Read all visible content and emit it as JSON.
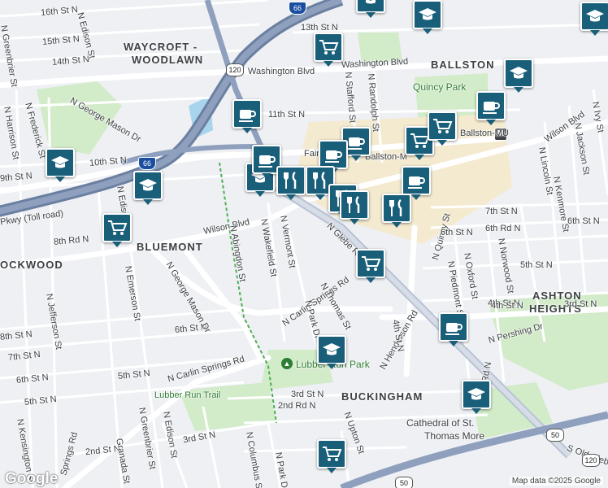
{
  "map": {
    "colors": {
      "road_major": "#ffffff",
      "highway": "#8a9bb5",
      "highway_dark": "#6b7fa0",
      "park": "#cfe8c6",
      "water": "#a8d4ee",
      "poi": "#1a5f7a",
      "background": "#eef0f4",
      "commercial": "#f6ecd3"
    },
    "areas": [
      "WAYCROFT -",
      "WOODLAWN",
      "BALLSTON",
      "BLUEMONT",
      "OCKWOOD",
      "ASHTON",
      "HEIGHTS",
      "BUCKINGHAM"
    ],
    "streets": [
      "16th St N",
      "N Edison St",
      "15th St N",
      "N Greenbrier St",
      "14th St N",
      "13th St N",
      "Washington Blvd",
      "Washington Blvd",
      "N George Mason Dr",
      "N Frederick St",
      "N Harrison St",
      "11th St N",
      "10th St N",
      "9th St N",
      "N Edison St",
      "Pkwy (Toll road)",
      "8th Rd N",
      "Wilson Blvd",
      "N Abingdon St",
      "N Wakefield St",
      "N Vermont St",
      "N Glebe Rd",
      "N Carlin Springs Rd",
      "N Thomas St",
      "N Park Dr",
      "N Henderson Rd",
      "N Emerson St",
      "N Jefferson St",
      "8th St N",
      "7th St N",
      "6th St N",
      "5th St N",
      "4th St N",
      "6th St N",
      "N George Mason Dr",
      "N Carlin Springs Rd",
      "5th St N",
      "Lubber Run Trail",
      "N Greenbrier St",
      "N Edison St",
      "3rd St N",
      "2nd St N",
      "Granada St",
      "2nd Rd N",
      "3rd St N",
      "N Upton St",
      "N Columbus St",
      "N Park Dr",
      "N Quincy St",
      "4th St N",
      "N Piedmont St",
      "N Oxford St",
      "N Norwood St",
      "N Kenmore St",
      "N Lincoln St",
      "N Jackson St",
      "N Ivy St",
      "Wilson Blvd",
      "7th St N",
      "6th Rd N",
      "6th St N",
      "6th St N",
      "5th St N",
      "4th St N",
      "3rd St N",
      "N Pershing Dr",
      "2nd Rd N",
      "S Old Glebe",
      "N Stafford St",
      "N Randolph St",
      "Ballston-M",
      "N Kensington St",
      "Springs Rd",
      "Fairfax Dr"
    ],
    "parks": [
      "Quincy Park",
      "Lubber Run Park",
      "Cathedral of St.",
      "Thomas More"
    ],
    "metro": {
      "label": "Ballston-MU",
      "code": "M",
      "name": "Ballston-MU"
    },
    "shields": [
      "66",
      "120",
      "66",
      "120",
      "50",
      "50"
    ],
    "logo": "Google",
    "attribution": "Map data ©2025 Google",
    "pois": [
      {
        "kind": "school",
        "icon": "graduation-cap"
      },
      {
        "kind": "school",
        "icon": "graduation-cap"
      },
      {
        "kind": "school",
        "icon": "graduation-cap"
      },
      {
        "kind": "school",
        "icon": "graduation-cap"
      },
      {
        "kind": "school",
        "icon": "graduation-cap"
      },
      {
        "kind": "school",
        "icon": "graduation-cap"
      },
      {
        "kind": "school",
        "icon": "graduation-cap"
      },
      {
        "kind": "school",
        "icon": "graduation-cap"
      },
      {
        "kind": "school",
        "icon": "graduation-cap"
      },
      {
        "kind": "grocery",
        "icon": "shopping-cart"
      },
      {
        "kind": "grocery",
        "icon": "shopping-cart"
      },
      {
        "kind": "grocery",
        "icon": "shopping-cart"
      },
      {
        "kind": "grocery",
        "icon": "shopping-cart"
      },
      {
        "kind": "grocery",
        "icon": "shopping-cart"
      },
      {
        "kind": "grocery",
        "icon": "shopping-cart"
      },
      {
        "kind": "cafe",
        "icon": "coffee-cup"
      },
      {
        "kind": "cafe",
        "icon": "coffee-cup"
      },
      {
        "kind": "cafe",
        "icon": "coffee-cup"
      },
      {
        "kind": "cafe",
        "icon": "coffee-cup"
      },
      {
        "kind": "cafe",
        "icon": "coffee-cup"
      },
      {
        "kind": "cafe",
        "icon": "coffee-cup"
      },
      {
        "kind": "cafe",
        "icon": "coffee-cup"
      },
      {
        "kind": "restaurant",
        "icon": "fork-knife"
      },
      {
        "kind": "restaurant",
        "icon": "fork-knife"
      },
      {
        "kind": "restaurant",
        "icon": "fork-knife"
      },
      {
        "kind": "restaurant",
        "icon": "fork-knife"
      },
      {
        "kind": "restaurant",
        "icon": "fork-knife"
      }
    ]
  }
}
